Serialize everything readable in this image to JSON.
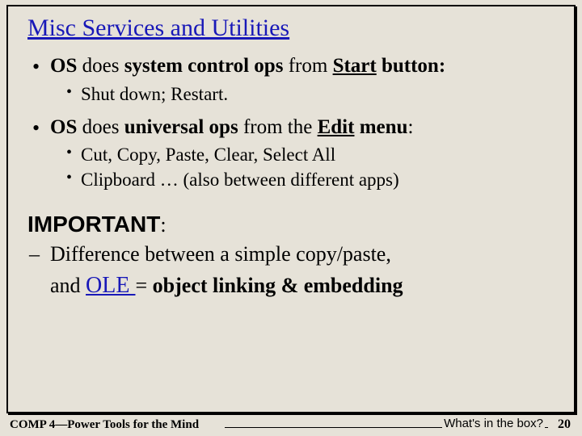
{
  "title": "Misc Services and Utilities",
  "bullets": [
    {
      "parts": [
        {
          "t": "OS",
          "b": true
        },
        {
          "t": " does "
        },
        {
          "t": "system control ops",
          "b": true
        },
        {
          "t": " from "
        },
        {
          "t": "Start",
          "b": true,
          "u": true
        },
        {
          "t": " button:",
          "b": true
        }
      ],
      "sub": [
        "Shut down; Restart."
      ]
    },
    {
      "parts": [
        {
          "t": "OS",
          "b": true
        },
        {
          "t": " does "
        },
        {
          "t": "universal ops",
          "b": true
        },
        {
          "t": " from the "
        },
        {
          "t": "Edit",
          "b": true,
          "u": true
        },
        {
          "t": " menu",
          "b": true
        },
        {
          "t": ":"
        }
      ],
      "sub": [
        "Cut, Copy, Paste, Clear, Select All",
        "Clipboard …   (also between different apps)"
      ]
    }
  ],
  "important_label": "IMPORTANT",
  "diff_line": "Difference between a simple copy/paste,",
  "and_prefix": "and ",
  "ole": "OLE ",
  "ole_suffix_parts": [
    {
      "t": " = "
    },
    {
      "t": "object linking & embedding",
      "b": true
    }
  ],
  "footer": {
    "left": "COMP 4—Power Tools for the Mind",
    "question": "What's in the box?",
    "page": "20"
  }
}
